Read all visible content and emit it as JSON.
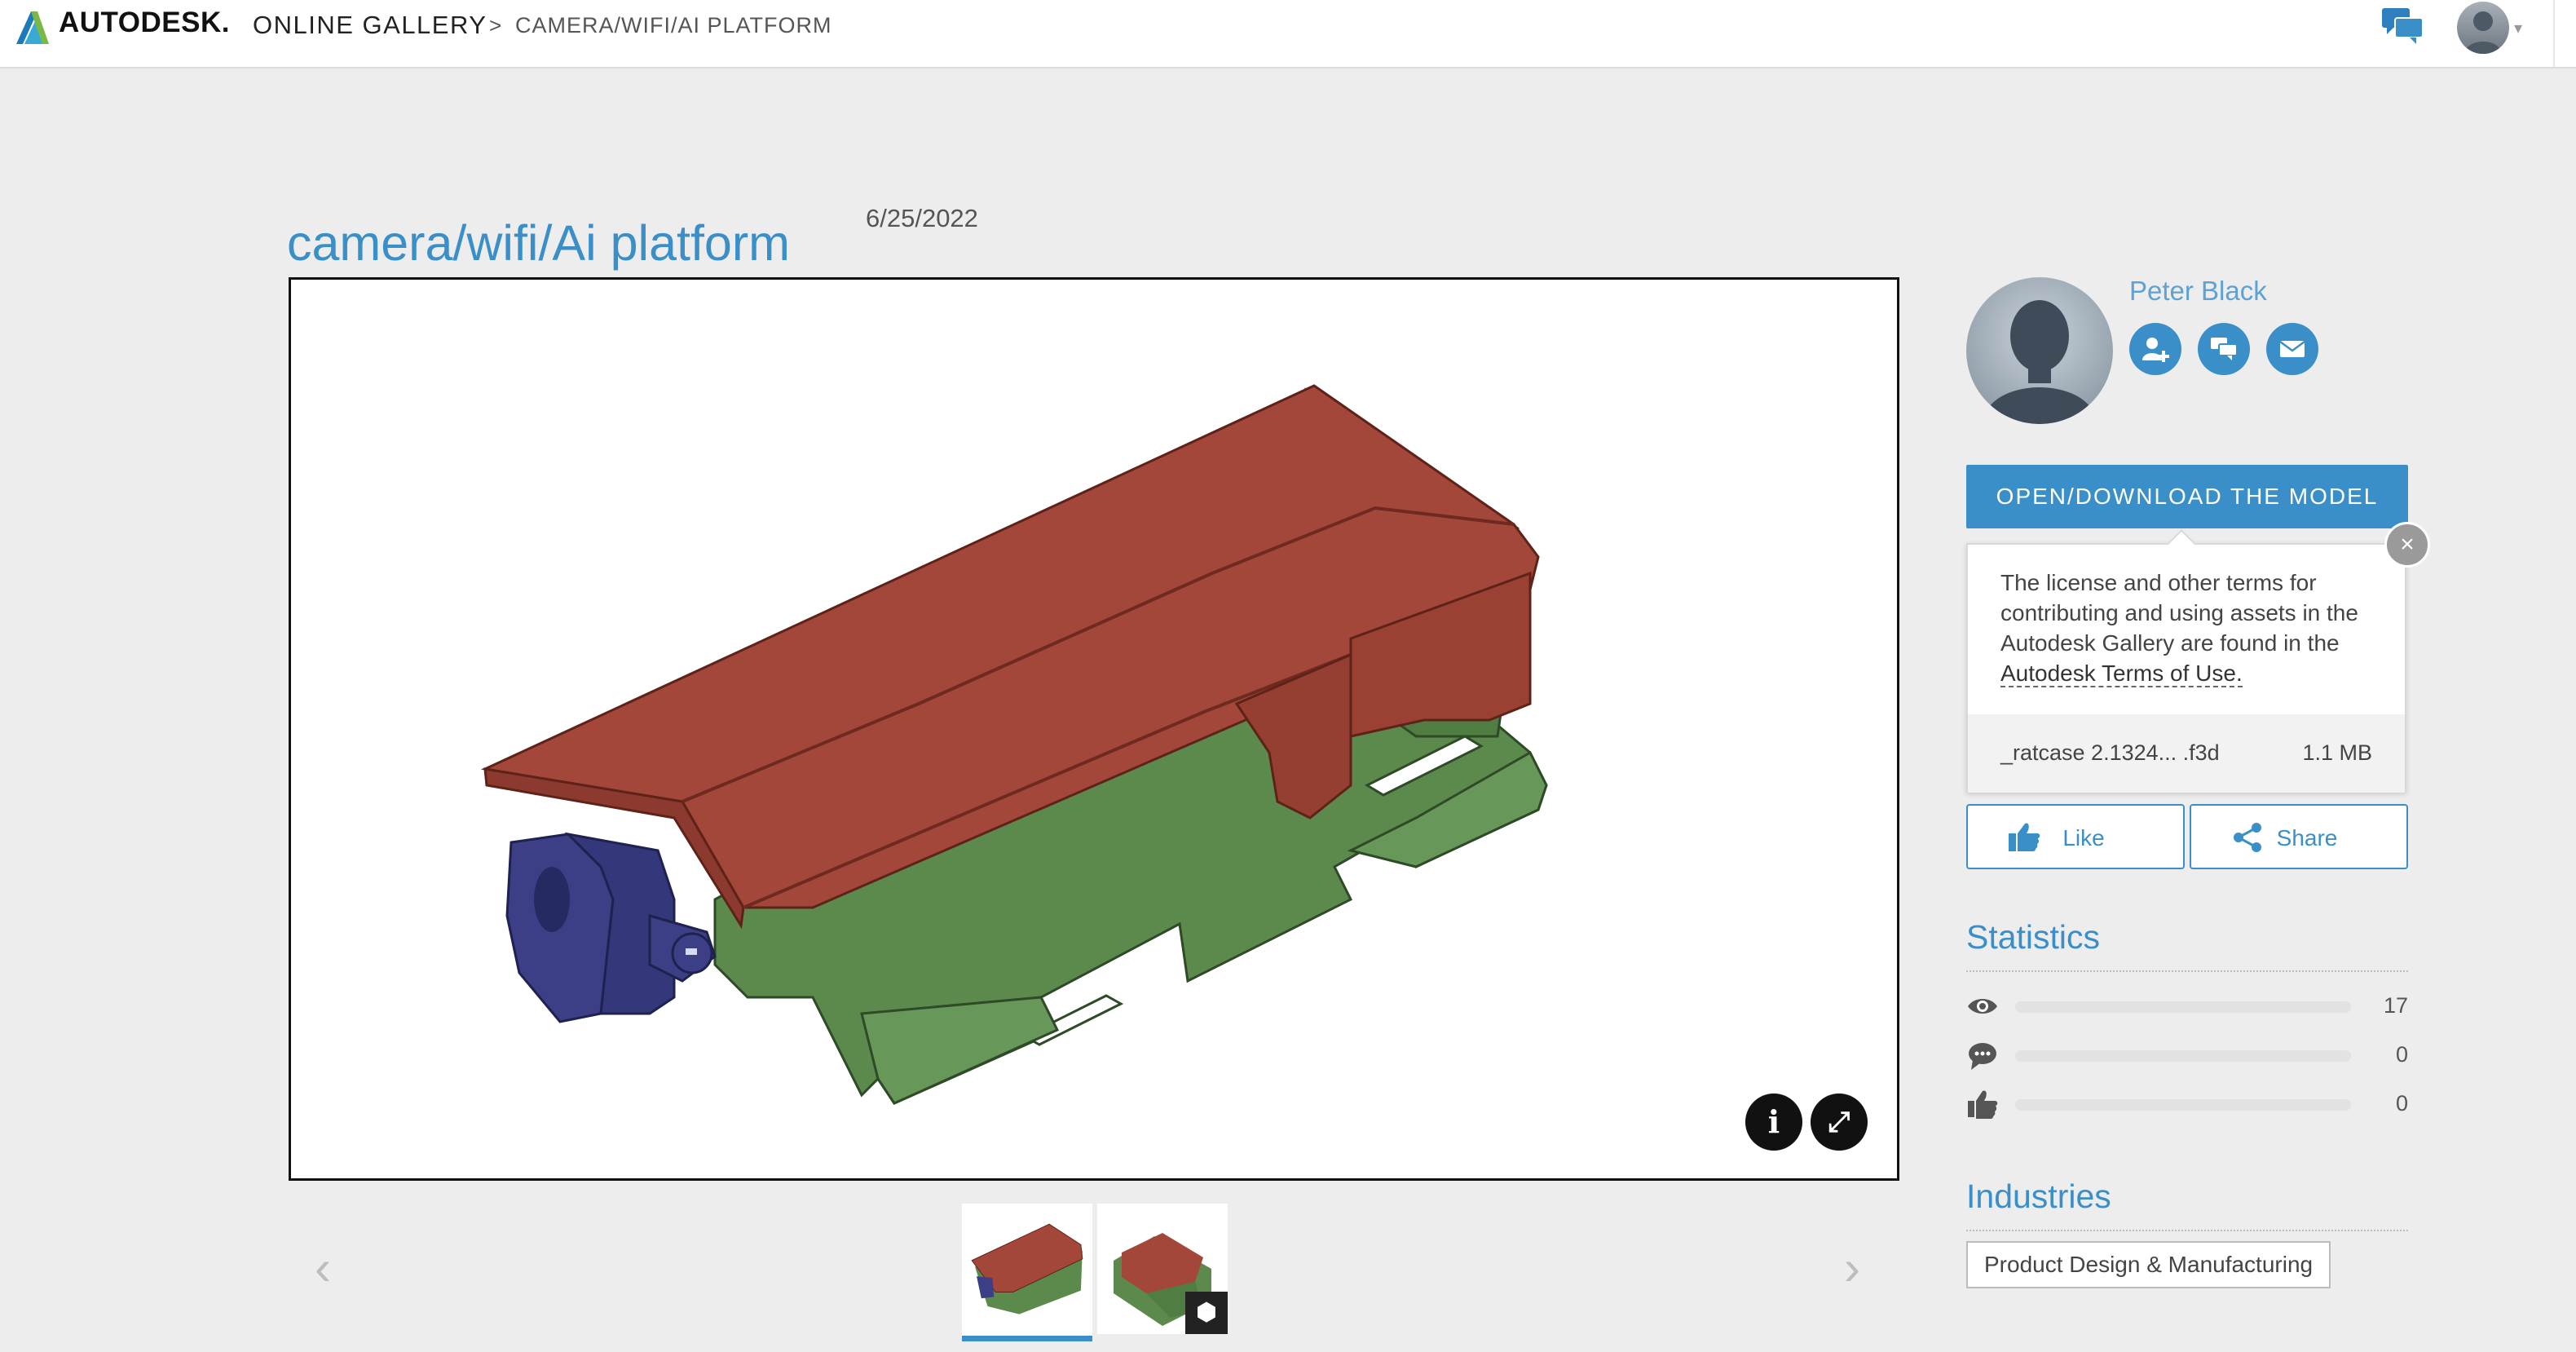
{
  "header": {
    "brand": "AUTODESK.",
    "gallery_label": "ONLINE GALLERY",
    "breadcrumb_separator": ">",
    "breadcrumb_current": "CAMERA/WIFI/AI PLATFORM",
    "user_menu_caret": "▾"
  },
  "page": {
    "title": "camera/wifi/Ai platform",
    "date": "6/25/2022"
  },
  "viewer": {
    "info_button": "i",
    "fullscreen_button": "⤢",
    "model_colors": {
      "top": "#a3473a",
      "body": "#5b8a4c",
      "clip": "#3c3f86"
    }
  },
  "thumbnails": {
    "prev_arrow": "‹",
    "next_arrow": "›",
    "badge_icon": "cube-icon"
  },
  "author": {
    "name": "Peter Black",
    "actions": [
      "follow-icon",
      "chat-icon",
      "mail-icon"
    ]
  },
  "download": {
    "button_label": "OPEN/DOWNLOAD THE MODEL",
    "terms_text": "The license and other terms for contributing and using assets in the Autodesk Gallery are found in the",
    "terms_link": "Autodesk Terms of Use.",
    "close_icon": "×",
    "file_name": "_ratcase 2.1324...  .f3d",
    "file_size": "1.1 MB"
  },
  "social": {
    "like_label": "Like",
    "share_label": "Share"
  },
  "statistics": {
    "title": "Statistics",
    "views": "17",
    "comments": "0",
    "likes": "0"
  },
  "industries": {
    "title": "Industries",
    "tags": [
      "Product Design & Manufacturing"
    ]
  },
  "colors": {
    "accent": "#3a8fc9",
    "background": "#ededed"
  }
}
